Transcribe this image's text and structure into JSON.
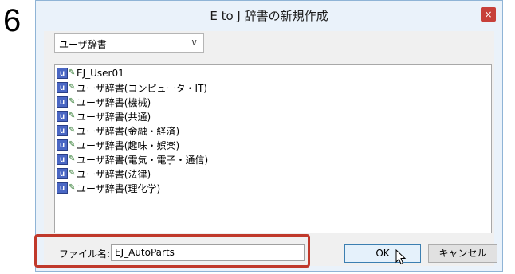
{
  "step_number": "6",
  "window": {
    "title": "E to J 辞書の新規作成",
    "close_glyph": "×"
  },
  "dictionary_type": {
    "selected": "ユーザ辞書"
  },
  "dictionary_list": {
    "icon_glyph": "u",
    "items": [
      "EJ_User01",
      "ユーザ辞書(コンピュータ・IT)",
      "ユーザ辞書(機械)",
      "ユーザ辞書(共通)",
      "ユーザ辞書(金融・経済)",
      "ユーザ辞書(趣味・娯楽)",
      "ユーザ辞書(電気・電子・通信)",
      "ユーザ辞書(法律)",
      "ユーザ辞書(理化学)"
    ]
  },
  "file_name": {
    "label": "ファイル名:",
    "value": "EJ_AutoParts"
  },
  "buttons": {
    "ok": "OK",
    "cancel": "キャンセル"
  },
  "colors": {
    "highlight_frame": "#c0392b",
    "close_button": "#c7403a",
    "dict_icon": "#4a67c4"
  }
}
